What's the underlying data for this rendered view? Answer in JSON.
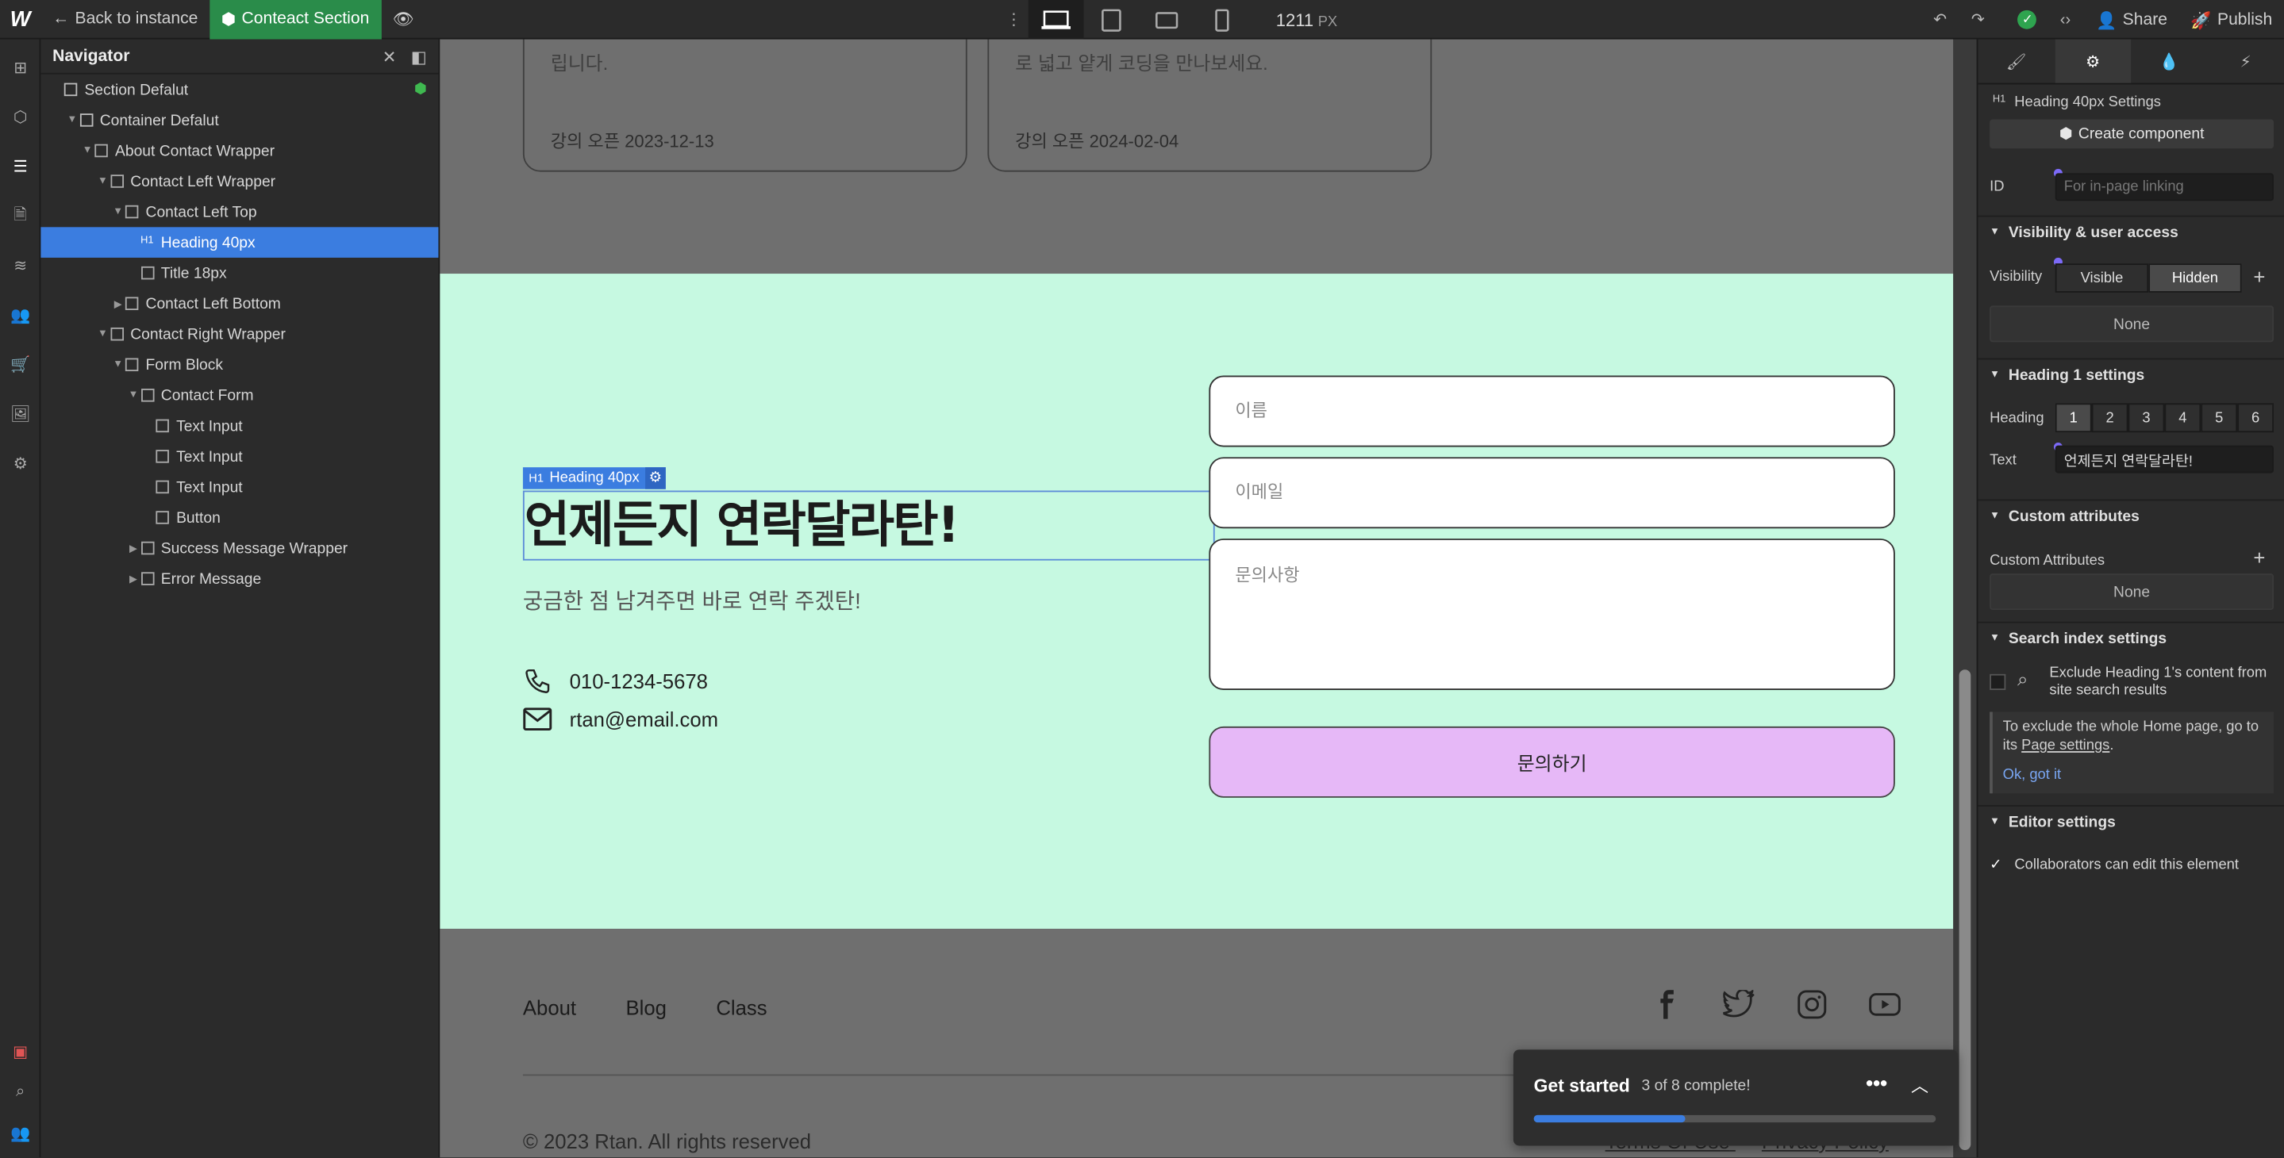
{
  "topbar": {
    "back": "Back to instance",
    "component": "Conteact Section",
    "width_value": "1211",
    "width_unit": "PX",
    "share": "Share",
    "publish": "Publish"
  },
  "navigator": {
    "title": "Navigator",
    "items": [
      {
        "label": "Section Defalut",
        "depth": 0
      },
      {
        "label": "Container Defalut",
        "depth": 1
      },
      {
        "label": "About Contact Wrapper",
        "depth": 2
      },
      {
        "label": "Contact Left Wrapper",
        "depth": 3
      },
      {
        "label": "Contact Left Top",
        "depth": 4
      },
      {
        "label": "Heading 40px",
        "depth": 5
      },
      {
        "label": "Title 18px",
        "depth": 5
      },
      {
        "label": "Contact Left Bottom",
        "depth": 4
      },
      {
        "label": "Contact Right Wrapper",
        "depth": 3
      },
      {
        "label": "Form Block",
        "depth": 4
      },
      {
        "label": "Contact Form",
        "depth": 5
      },
      {
        "label": "Text Input",
        "depth": 6
      },
      {
        "label": "Text Input",
        "depth": 6
      },
      {
        "label": "Text Input",
        "depth": 6
      },
      {
        "label": "Button",
        "depth": 6
      },
      {
        "label": "Success Message Wrapper",
        "depth": 5
      },
      {
        "label": "Error Message",
        "depth": 5
      }
    ]
  },
  "canvas": {
    "cards": [
      {
        "text": "립니다.",
        "date": "강의 오픈 2023-12-13"
      },
      {
        "text": "로 넓고 얕게 코딩을 만나보세요.",
        "date": "강의 오픈 2024-02-04"
      }
    ],
    "selected_tag": "Heading 40px",
    "heading": "언제든지 연락달라탄!",
    "subtitle": "궁금한 점 남겨주면 바로 연락 주겠탄!",
    "phone": "010-1234-5678",
    "email": "rtan@email.com",
    "form": {
      "name_placeholder": "이름",
      "email_placeholder": "이메일",
      "message_placeholder": "문의사항",
      "submit": "문의하기"
    },
    "footer": {
      "links": [
        "About",
        "Blog",
        "Class"
      ],
      "copyright": "© 2023 Rtan. All rights reserved",
      "legal": [
        "Terms Of Use",
        "Privacy Policy"
      ]
    }
  },
  "get_started": {
    "title": "Get started",
    "progress_text": "3 of 8 complete!",
    "progress_fraction": 0.375
  },
  "settings": {
    "element_title": "Heading 40px Settings",
    "create_component": "Create component",
    "id_label": "ID",
    "id_placeholder": "For in-page linking",
    "visibility_section": "Visibility & user access",
    "visibility_label": "Visibility",
    "visible": "Visible",
    "hidden": "Hidden",
    "none": "None",
    "heading_section": "Heading 1 settings",
    "heading_label": "Heading",
    "heading_levels": [
      "1",
      "2",
      "3",
      "4",
      "5",
      "6"
    ],
    "text_label": "Text",
    "text_value": "언제든지 연락달라탄!",
    "custom_section": "Custom attributes",
    "custom_label": "Custom Attributes",
    "search_section": "Search index settings",
    "exclude_text": "Exclude Heading 1's content from site search results",
    "info_text": "To exclude the whole Home page, go to its",
    "info_link": "Page settings",
    "info_dismiss": "Ok, got it",
    "editor_section": "Editor settings",
    "collab_text": "Collaborators can edit this element"
  }
}
